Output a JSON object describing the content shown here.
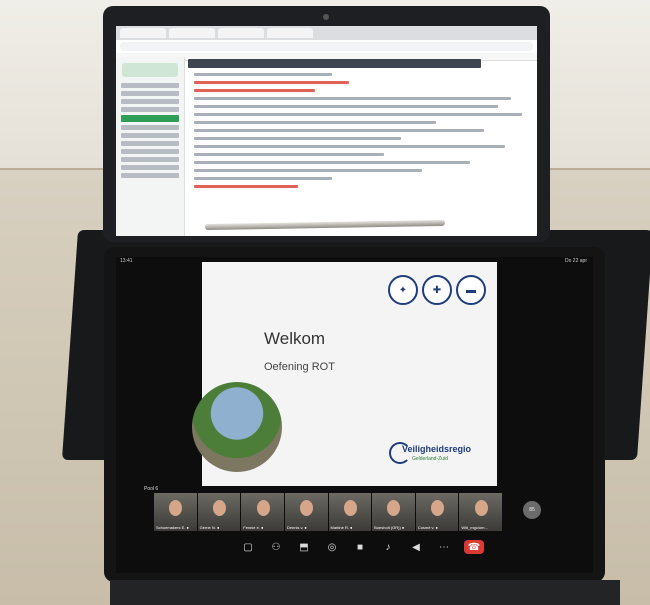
{
  "slide": {
    "title": "Welkom",
    "subtitle": "Oefening ROT",
    "org_name": "Veiligheidsregio",
    "org_sub": "Gelderland-Zuid"
  },
  "status_bar": {
    "time": "13:41",
    "date": "Do 22 apr"
  },
  "participants": [
    "Schoemakers E. ●",
    "Gerrie N. ●",
    "Fennie e. ●",
    "Dennis v. ●",
    "Martine R. ●",
    "Boesholt (GR)) ●",
    "Cosmé v. ●",
    "Wilt_mgc/om..."
  ],
  "gallery_label": "Pool 6",
  "participant_count": "85",
  "controls": [
    "camera-toggle",
    "people",
    "share",
    "chat",
    "video",
    "mute",
    "speaker",
    "more",
    "hang-up"
  ],
  "colors": {
    "org_blue": "#1f3d7a",
    "org_green": "#2d7a3a",
    "hangup_red": "#d93a34"
  }
}
